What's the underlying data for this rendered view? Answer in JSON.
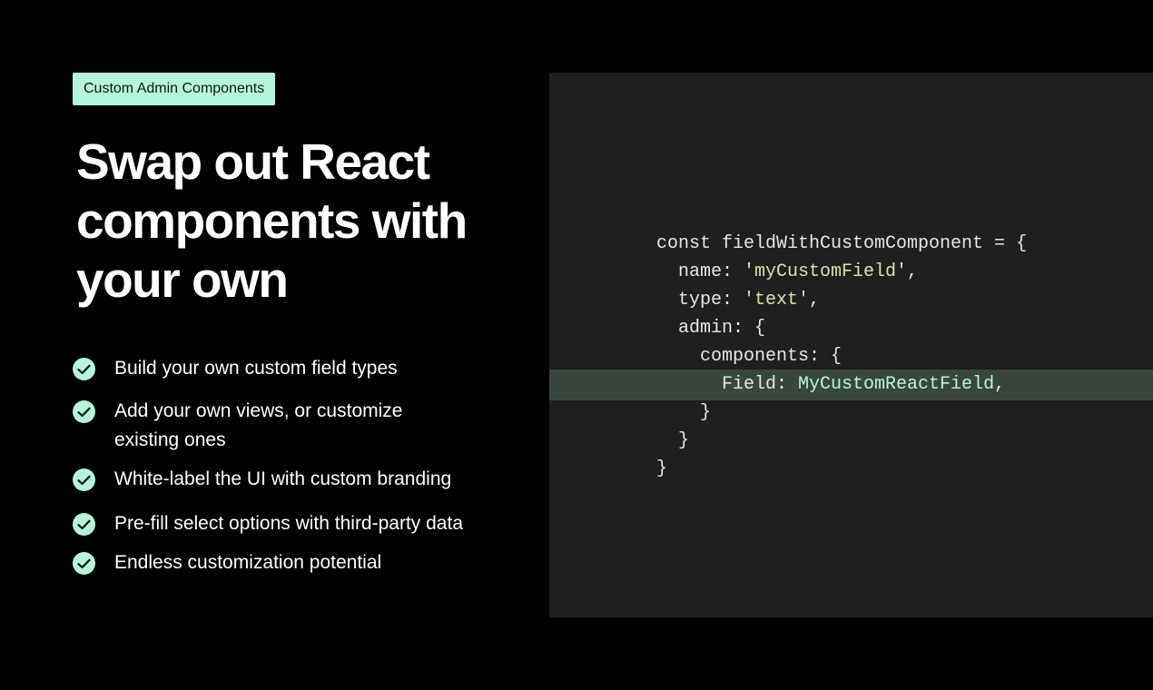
{
  "badge": {
    "label": "Custom Admin Components"
  },
  "headline": "Swap out React components with your own",
  "features": [
    {
      "text": "Build your own custom field types",
      "icon": "check-icon"
    },
    {
      "text": "Add your own views, or customize existing ones",
      "icon": "check-icon"
    },
    {
      "text": "White-label the UI with custom branding",
      "icon": "check-icon"
    },
    {
      "text": "Pre-fill select options with third-party data",
      "icon": "check-icon"
    },
    {
      "text": "Endless customization potential",
      "icon": "check-icon"
    }
  ],
  "code": {
    "lines": [
      {
        "parts": [
          {
            "text": "const fieldWithCustomComponent = {",
            "kind": "plain"
          }
        ]
      },
      {
        "parts": [
          {
            "text": "  name: ",
            "kind": "plain"
          },
          {
            "text": "'myCustomField'",
            "kind": "string"
          },
          {
            "text": ",",
            "kind": "plain"
          }
        ]
      },
      {
        "parts": [
          {
            "text": "  type: ",
            "kind": "plain"
          },
          {
            "text": "'text'",
            "kind": "string"
          },
          {
            "text": ",",
            "kind": "plain"
          }
        ]
      },
      {
        "parts": [
          {
            "text": "  admin: {",
            "kind": "plain"
          }
        ]
      },
      {
        "parts": [
          {
            "text": "    components: {",
            "kind": "plain"
          }
        ]
      },
      {
        "parts": [
          {
            "text": "      Field: ",
            "kind": "plain"
          },
          {
            "text": "MyCustomReactField",
            "kind": "identifier"
          },
          {
            "text": ",",
            "kind": "plain"
          }
        ],
        "highlighted": true
      },
      {
        "parts": [
          {
            "text": "    }",
            "kind": "plain"
          }
        ]
      },
      {
        "parts": [
          {
            "text": "  }",
            "kind": "plain"
          }
        ]
      },
      {
        "parts": [
          {
            "text": "}",
            "kind": "plain"
          }
        ]
      }
    ]
  },
  "colors": {
    "background": "#000000",
    "accent": "#b5f5dc",
    "code_panel": "#1f1f1f",
    "code_highlight": "#38463f",
    "code_string": "#d9e4a2"
  }
}
